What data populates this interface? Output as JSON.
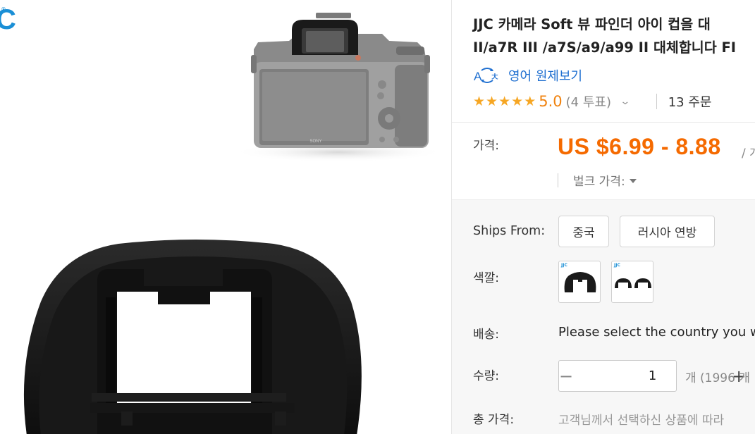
{
  "gallery": {
    "brand_mark": "C",
    "brand_reg": "®",
    "camera_brand": "SONY",
    "swatch_logo": "JJC"
  },
  "product": {
    "title_line1": "JJC 카메라 Soft 뷰 파인더 아이 컵을 대",
    "title_line2": "II/a7R III /a7S/a9/a99 II 대체합니다 FI"
  },
  "translate": {
    "icon": "translate-icon",
    "label": "영어 원제보기"
  },
  "rating": {
    "stars": 5,
    "star_glyph": "★",
    "score": "5.0",
    "reviews": "(4 투표)",
    "chevron": "⌄",
    "orders": "13 주문"
  },
  "price": {
    "label": "가격:",
    "value": "US $6.99 - 8.88",
    "unit": "/ 개",
    "bulk_label": "벌크 가격:"
  },
  "options": {
    "ships_from_label": "Ships From:",
    "ships_from": [
      "중국",
      "러시아 연방"
    ],
    "color_label": "색깔:",
    "shipping_label": "배송:",
    "shipping_text": "Please select the country you w",
    "quantity_label": "수량:",
    "quantity_value": "1",
    "minus": "−",
    "plus": "+",
    "quantity_available": "개 (1996 개",
    "total_label": "총 가격:",
    "total_text": "고객님께서 선택하신 상품에 따라"
  },
  "colors": {
    "accent_orange": "#f56a00",
    "link_blue": "#1f6fd0",
    "star_gold": "#f6a623"
  }
}
